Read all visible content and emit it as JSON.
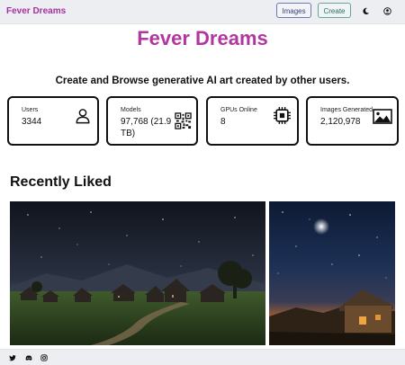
{
  "nav": {
    "brand": "Fever Dreams",
    "images_label": "Images",
    "create_label": "Create",
    "theme_icon": "moon-icon",
    "account_icon": "user-circle-icon"
  },
  "hero": {
    "title": "Fever Dreams",
    "tagline": "Create and Browse generative AI art created by other users."
  },
  "stats": [
    {
      "label": "Users",
      "value": "3344",
      "icon": "user-icon"
    },
    {
      "label": "Models",
      "value": "97,768 (21.9 TB)",
      "icon": "qr-code-icon"
    },
    {
      "label": "GPUs Online",
      "value": "8",
      "icon": "cpu-chip-icon"
    },
    {
      "label": "Images Generated",
      "value": "2,120,978",
      "icon": "image-icon"
    }
  ],
  "recent": {
    "title": "Recently Liked",
    "images": [
      {
        "icon": "night-village-landscape-image"
      },
      {
        "icon": "starry-night-cottage-image"
      }
    ]
  },
  "footer": {
    "icons": [
      "twitter-icon",
      "discord-icon",
      "instagram-icon"
    ]
  },
  "colors": {
    "brand": "#a4329e",
    "title": "#b2369f",
    "nav_bg": "#edeef1"
  }
}
